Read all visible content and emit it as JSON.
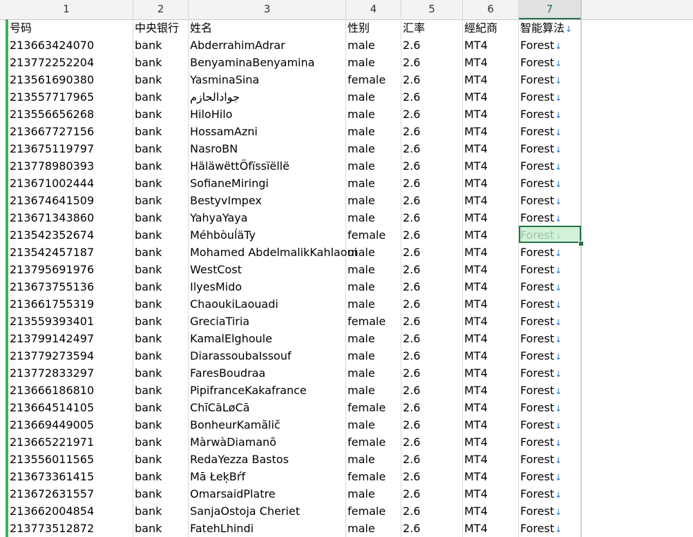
{
  "column_headers": [
    "1",
    "2",
    "3",
    "4",
    "5",
    "6",
    "7"
  ],
  "active_column": 6,
  "header_row": {
    "c1": "号码",
    "c2": "中央银行",
    "c3": "姓名",
    "c4": "性别",
    "c5": "汇率",
    "c6": "經紀商",
    "c7": "智能算法"
  },
  "selected_row": 11,
  "rows": [
    [
      "213663424070",
      "bank",
      "AbderrahimAdrar",
      "male",
      "2.6",
      "MT4",
      "Forest"
    ],
    [
      "213772252204",
      "bank",
      "BenyaminaBenyamina",
      "male",
      "2.6",
      "MT4",
      "Forest"
    ],
    [
      "213561690380",
      "bank",
      "YasminaSina",
      "female",
      "2.6",
      "MT4",
      "Forest"
    ],
    [
      "213557717965",
      "bank",
      "جوادالحازم",
      "male",
      "2.6",
      "MT4",
      "Forest"
    ],
    [
      "213556656268",
      "bank",
      "HiloHilo",
      "male",
      "2.6",
      "MT4",
      "Forest"
    ],
    [
      "213667727156",
      "bank",
      "HossamAzni",
      "male",
      "2.6",
      "MT4",
      "Forest"
    ],
    [
      "213675119797",
      "bank",
      "NasroBN",
      "male",
      "2.6",
      "MT4",
      "Forest"
    ],
    [
      "213778980393",
      "bank",
      "HäläwëttÖfïssïëllë",
      "male",
      "2.6",
      "MT4",
      "Forest"
    ],
    [
      "213671002444",
      "bank",
      "SofianeMiringi",
      "male",
      "2.6",
      "MT4",
      "Forest"
    ],
    [
      "213674641509",
      "bank",
      "BestyvImpex",
      "male",
      "2.6",
      "MT4",
      "Forest"
    ],
    [
      "213671343860",
      "bank",
      "YahyaYaya",
      "male",
      "2.6",
      "MT4",
      "Forest"
    ],
    [
      "213542352674",
      "bank",
      "MéhbòuĺäTy",
      "female",
      "2.6",
      "MT4",
      "Forest"
    ],
    [
      "213542457187",
      "bank",
      "Mohamed AbdelmalikKahlaoui",
      "male",
      "2.6",
      "MT4",
      "Forest"
    ],
    [
      "213795691976",
      "bank",
      "WestCost",
      "male",
      "2.6",
      "MT4",
      "Forest"
    ],
    [
      "213673755136",
      "bank",
      "IlyesMido",
      "male",
      "2.6",
      "MT4",
      "Forest"
    ],
    [
      "213661755319",
      "bank",
      "ChaoukiLaouadi",
      "male",
      "2.6",
      "MT4",
      "Forest"
    ],
    [
      "213559393401",
      "bank",
      "GreciaTiria",
      "female",
      "2.6",
      "MT4",
      "Forest"
    ],
    [
      "213799142497",
      "bank",
      "KamalElghoule",
      "male",
      "2.6",
      "MT4",
      "Forest"
    ],
    [
      "213779273594",
      "bank",
      "DiarassoubaIssouf",
      "male",
      "2.6",
      "MT4",
      "Forest"
    ],
    [
      "213772833297",
      "bank",
      "FaresBoudraa",
      "male",
      "2.6",
      "MT4",
      "Forest"
    ],
    [
      "213666186810",
      "bank",
      "PipifranceKakafrance",
      "male",
      "2.6",
      "MT4",
      "Forest"
    ],
    [
      "213664514105",
      "bank",
      "ChīCăLøCā",
      "female",
      "2.6",
      "MT4",
      "Forest"
    ],
    [
      "213669449005",
      "bank",
      "BonheurKamãlič",
      "male",
      "2.6",
      "MT4",
      "Forest"
    ],
    [
      "213665221971",
      "bank",
      "MàrwàDiamanõ",
      "female",
      "2.6",
      "MT4",
      "Forest"
    ],
    [
      "213556011565",
      "bank",
      "RedaYezza Bastos",
      "male",
      "2.6",
      "MT4",
      "Forest"
    ],
    [
      "213673361415",
      "bank",
      "Mā ŁeķBŕf",
      "female",
      "2.6",
      "MT4",
      "Forest"
    ],
    [
      "213672631557",
      "bank",
      "OmarsaidPlatre",
      "male",
      "2.6",
      "MT4",
      "Forest"
    ],
    [
      "213662004854",
      "bank",
      "SanjaOstoja Cheriet",
      "female",
      "2.6",
      "MT4",
      "Forest"
    ],
    [
      "213773512872",
      "bank",
      "FatehLhindi",
      "male",
      "2.6",
      "MT4",
      "Forest"
    ]
  ],
  "icons": {
    "filter": "filter-arrow-icon"
  }
}
